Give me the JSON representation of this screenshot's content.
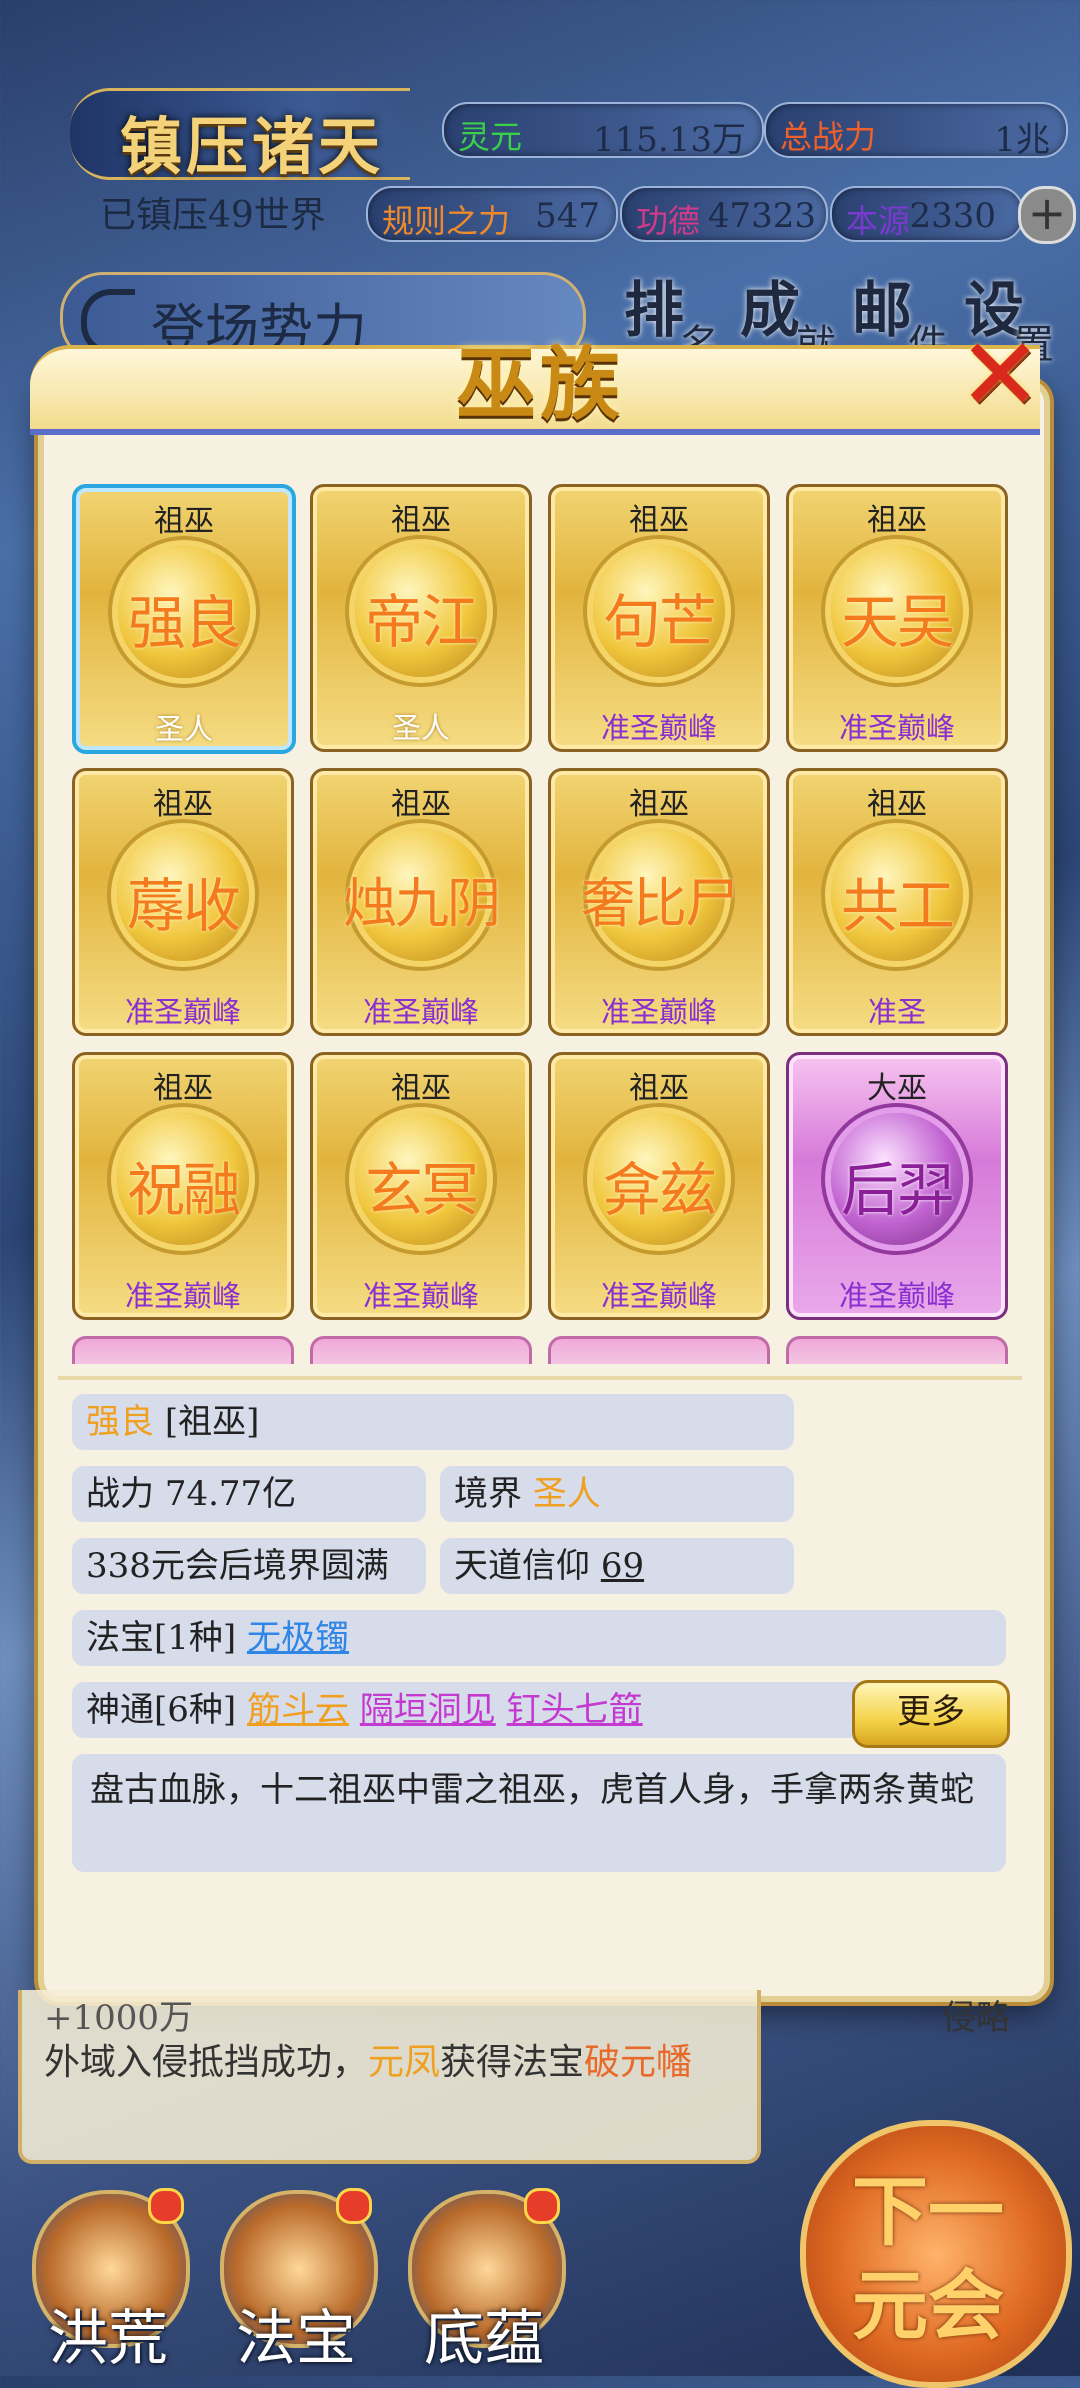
{
  "hud": {
    "game_title": "镇压诸天",
    "suppressed_worlds": "已镇压49世界",
    "stats": [
      {
        "label": "灵元",
        "value": "115.13万",
        "label_color": "#3bd04a"
      },
      {
        "label": "总战力",
        "value": "1兆",
        "label_color": "#f0602a"
      },
      {
        "label": "规则之力",
        "value": "547",
        "label_color": "#f08a2a"
      },
      {
        "label": "功德",
        "value": "47323",
        "label_color": "#d23a8a"
      },
      {
        "label": "本源",
        "value": "2330",
        "label_color": "#7a3ad0"
      }
    ],
    "plus_symbol": "+",
    "power_button": "登场势力",
    "nav": [
      {
        "big": "排",
        "small": "名"
      },
      {
        "big": "成",
        "small": "就"
      },
      {
        "big": "邮",
        "small": "件"
      },
      {
        "big": "设",
        "small": "置"
      }
    ]
  },
  "modal": {
    "title": "巫族",
    "close_symbol": "✕",
    "cards": [
      {
        "rank": "祖巫",
        "name": "强良",
        "realm": "圣人",
        "realm_type": "saint",
        "style": "gold",
        "selected": true
      },
      {
        "rank": "祖巫",
        "name": "帝江",
        "realm": "圣人",
        "realm_type": "saint",
        "style": "gold"
      },
      {
        "rank": "祖巫",
        "name": "句芒",
        "realm": "准圣巅峰",
        "realm_type": "quasi",
        "style": "gold"
      },
      {
        "rank": "祖巫",
        "name": "天吴",
        "realm": "准圣巅峰",
        "realm_type": "quasi",
        "style": "gold"
      },
      {
        "rank": "祖巫",
        "name": "蓐收",
        "realm": "准圣巅峰",
        "realm_type": "quasi",
        "style": "gold"
      },
      {
        "rank": "祖巫",
        "name": "烛九阴",
        "realm": "准圣巅峰",
        "realm_type": "quasi",
        "style": "gold"
      },
      {
        "rank": "祖巫",
        "name": "奢比尸",
        "realm": "准圣巅峰",
        "realm_type": "quasi",
        "style": "gold"
      },
      {
        "rank": "祖巫",
        "name": "共工",
        "realm": "准圣",
        "realm_type": "quasi",
        "style": "gold"
      },
      {
        "rank": "祖巫",
        "name": "祝融",
        "realm": "准圣巅峰",
        "realm_type": "quasi",
        "style": "gold"
      },
      {
        "rank": "祖巫",
        "name": "玄冥",
        "realm": "准圣巅峰",
        "realm_type": "quasi",
        "style": "gold"
      },
      {
        "rank": "祖巫",
        "name": "弇兹",
        "realm": "准圣巅峰",
        "realm_type": "quasi",
        "style": "gold"
      },
      {
        "rank": "大巫",
        "name": "后羿",
        "realm": "准圣巅峰",
        "realm_type": "quasi",
        "style": "purple"
      }
    ],
    "detail": {
      "name": "强良",
      "rank_bracket": "[祖巫]",
      "power_label": "战力",
      "power_value": "74.77亿",
      "realm_label": "境界",
      "realm_value": "圣人",
      "perfect_text": "338元会后境界圆满",
      "faith_label": "天道信仰",
      "faith_value": "69",
      "treasure_label": "法宝[1种]",
      "treasure_items": [
        "无极镯"
      ],
      "skill_label": "神通[6种]",
      "skill_items": [
        "筋斗云",
        "隔垣洞见",
        "钉头七箭"
      ],
      "more_button": "更多",
      "description": "盘古血脉，十二祖巫中雷之祖巫，虎首人身，手拿两条黄蛇"
    }
  },
  "log": {
    "cut_line": "+1000万",
    "prefix": "外域入侵抵挡成功，",
    "person": "元凤",
    "middle": "获得法宝",
    "item": "破元幡",
    "right_cut": "侵略"
  },
  "bottom_nav": [
    {
      "label": "洪荒",
      "badge": true
    },
    {
      "label": "法宝",
      "badge": true
    },
    {
      "label": "底蕴",
      "badge": true
    }
  ],
  "next_button": {
    "line1": "下一",
    "line2": "元会"
  }
}
